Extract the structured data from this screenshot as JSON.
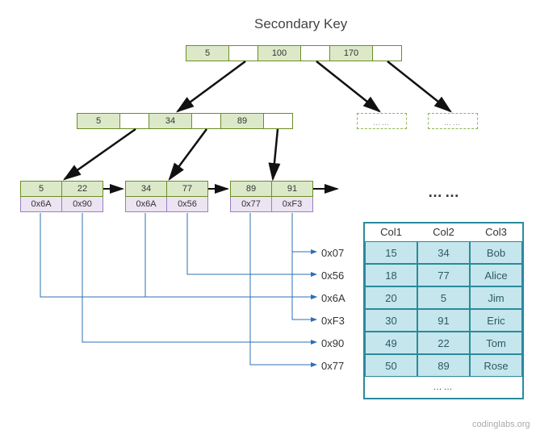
{
  "title": "Secondary Key",
  "root": {
    "k0": "5",
    "k1": "100",
    "k2": "170"
  },
  "internal": {
    "k0": "5",
    "k1": "34",
    "k2": "89"
  },
  "ghost_label": "……",
  "leaves": [
    {
      "k0": "5",
      "k1": "22",
      "h0": "0x6A",
      "h1": "0x90"
    },
    {
      "k0": "34",
      "k1": "77",
      "h0": "0x6A",
      "h1": "0x56"
    },
    {
      "k0": "89",
      "k1": "91",
      "h0": "0x77",
      "h1": "0xF3"
    }
  ],
  "ellipsis": "……",
  "addresses": [
    "0x07",
    "0x56",
    "0x6A",
    "0xF3",
    "0x90",
    "0x77"
  ],
  "table": {
    "headers": [
      "Col1",
      "Col2",
      "Col3"
    ],
    "rows": [
      [
        "15",
        "34",
        "Bob"
      ],
      [
        "18",
        "77",
        "Alice"
      ],
      [
        "20",
        "5",
        "Jim"
      ],
      [
        "30",
        "91",
        "Eric"
      ],
      [
        "49",
        "22",
        "Tom"
      ],
      [
        "50",
        "89",
        "Rose"
      ]
    ],
    "footer": "……"
  },
  "credit": "codinglabs.org",
  "chart_data": {
    "type": "table",
    "description": "B+Tree secondary index: root/internal nodes with keys, leaves with key→hex-pointer pairs referencing rows in a 3-column data table.",
    "root_keys": [
      5,
      100,
      170
    ],
    "internal_keys": [
      5,
      34,
      89
    ],
    "leaf_entries": [
      {
        "key": 5,
        "ptr": "0x6A"
      },
      {
        "key": 22,
        "ptr": "0x90"
      },
      {
        "key": 34,
        "ptr": "0x6A"
      },
      {
        "key": 77,
        "ptr": "0x56"
      },
      {
        "key": 89,
        "ptr": "0x77"
      },
      {
        "key": 91,
        "ptr": "0xF3"
      }
    ],
    "address_labels": [
      "0x07",
      "0x56",
      "0x6A",
      "0xF3",
      "0x90",
      "0x77"
    ],
    "data_table": {
      "columns": [
        "Col1",
        "Col2",
        "Col3"
      ],
      "rows": [
        [
          15,
          34,
          "Bob"
        ],
        [
          18,
          77,
          "Alice"
        ],
        [
          20,
          5,
          "Jim"
        ],
        [
          30,
          91,
          "Eric"
        ],
        [
          49,
          22,
          "Tom"
        ],
        [
          50,
          89,
          "Rose"
        ]
      ]
    }
  }
}
